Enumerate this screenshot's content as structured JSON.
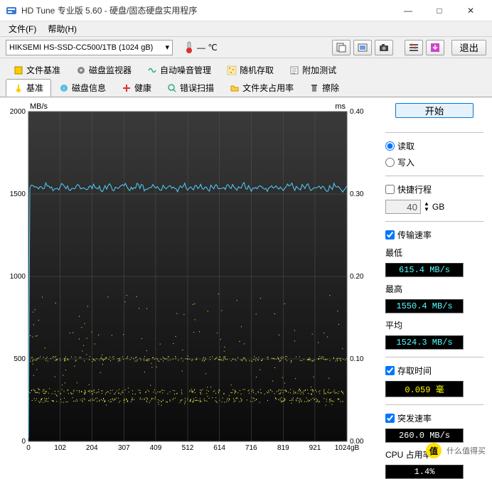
{
  "window": {
    "title": "HD Tune 专业版 5.60 - 硬盘/固态硬盘实用程序",
    "menu": {
      "file": "文件(F)",
      "help": "帮助(H)"
    },
    "buttons": {
      "min": "—",
      "max": "□",
      "close": "✕"
    }
  },
  "toolbar": {
    "drive": "HIKSEMI HS-SSD-CC500/1TB (1024 gB)",
    "temp": "— ℃",
    "exit": "退出"
  },
  "tabs_row1": [
    {
      "label": "文件基准"
    },
    {
      "label": "磁盘监视器"
    },
    {
      "label": "自动噪音管理"
    },
    {
      "label": "随机存取"
    },
    {
      "label": "附加测试"
    }
  ],
  "tabs_row2": [
    {
      "label": "基准",
      "active": true
    },
    {
      "label": "磁盘信息"
    },
    {
      "label": "健康"
    },
    {
      "label": "错误扫描"
    },
    {
      "label": "文件夹占用率"
    },
    {
      "label": "擦除"
    }
  ],
  "side": {
    "start": "开始",
    "read": "读取",
    "write": "写入",
    "shortstroke": "快捷行程",
    "shortstroke_val": "40",
    "gb": "GB",
    "transfer_rate": "传输速率",
    "min_label": "最低",
    "min_val": "615.4 MB/s",
    "max_label": "最高",
    "max_val": "1550.4 MB/s",
    "avg_label": "平均",
    "avg_val": "1524.3 MB/s",
    "access_label": "存取时间",
    "access_val": "0.059 毫",
    "burst_label": "突发速率",
    "burst_val": "260.0 MB/s",
    "cpu_label": "CPU 占用率",
    "cpu_val": "1.4%"
  },
  "watermark": {
    "text": "什么值得买"
  },
  "chart_data": {
    "type": "line+scatter",
    "xlabel": "gB",
    "y_left_label": "MB/s",
    "y_right_label": "ms",
    "x_ticks": [
      0,
      102,
      204,
      307,
      409,
      512,
      614,
      716,
      819,
      921,
      1024
    ],
    "y_left_ticks": [
      0,
      500,
      1000,
      1500,
      2000
    ],
    "y_right_ticks": [
      0,
      0.1,
      0.2,
      0.3,
      0.4
    ],
    "ylim_left": [
      0,
      2000
    ],
    "ylim_right": [
      0,
      0.4
    ],
    "xlim": [
      0,
      1024
    ],
    "series": [
      {
        "name": "transfer_rate",
        "axis": "left",
        "color": "#4fd2ff",
        "style": "line",
        "note": "transfer rate MB/s vs position; initial ramp then ~1540",
        "x": [
          0,
          2,
          5,
          1024
        ],
        "y": [
          20,
          1500,
          1540,
          1540
        ],
        "jitter": 25
      },
      {
        "name": "access_time",
        "axis": "right",
        "color": "#ffff55",
        "style": "scatter",
        "note": "access time ms; dense bands ~0.05, ~0.06, ~0.10; sparse up to 0.18",
        "band_values": [
          0.05,
          0.06,
          0.1
        ],
        "scatter_range": [
          0.04,
          0.18
        ],
        "x_range": [
          0,
          1024
        ]
      }
    ]
  }
}
